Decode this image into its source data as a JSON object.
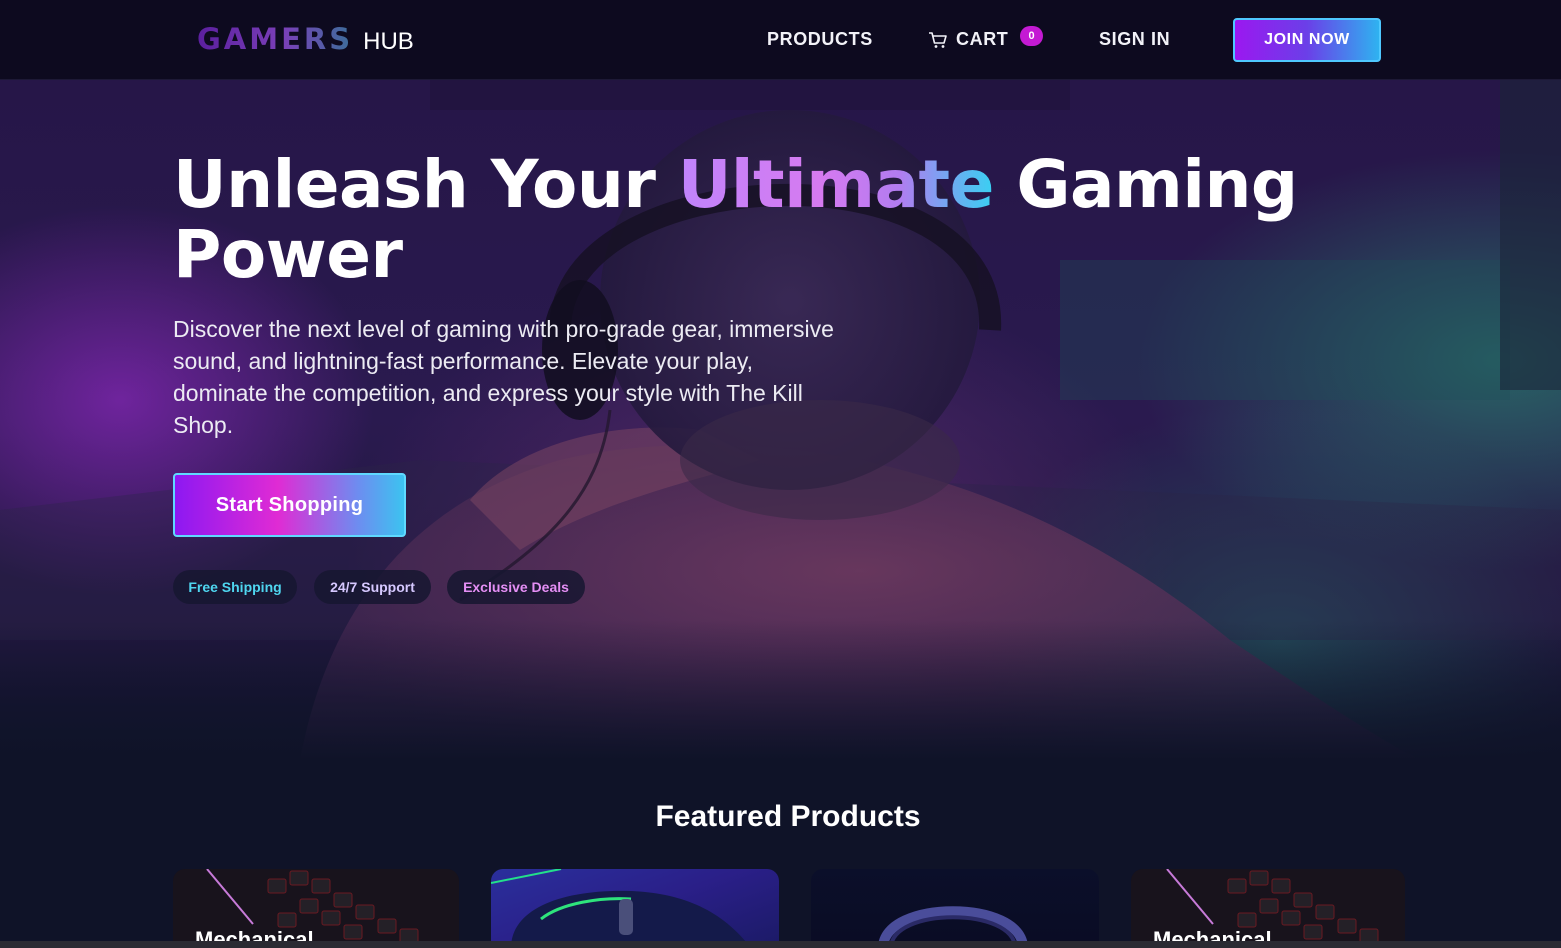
{
  "nav": {
    "logo_main": "GAMERS",
    "logo_sub": "HUB",
    "products": "PRODUCTS",
    "cart": "CART",
    "cart_count": "0",
    "signin": "SIGN IN",
    "join": "JOIN NOW"
  },
  "hero": {
    "headline_before": "Unleash Your ",
    "headline_accent": "Ultimate",
    "headline_after": " Gaming Power",
    "subtext": "Discover the next level of gaming with pro-grade gear, immersive sound, and lightning-fast performance. Elevate your play, dominate the competition, and express your style with The Kill Shop.",
    "cta": "Start Shopping",
    "chips": [
      "Free Shipping",
      "24/7 Support",
      "Exclusive Deals"
    ]
  },
  "featured": {
    "title": "Featured Products",
    "cards": [
      {
        "title": "Mechanical"
      },
      {
        "title": ""
      },
      {
        "title": ""
      },
      {
        "title": "Mechanical"
      }
    ]
  },
  "colors": {
    "accent_purple": "#9b18f0",
    "accent_cyan": "#2fb2f0",
    "badge": "#c41ad3",
    "background": "#0f1328"
  },
  "icons": {
    "cart": "cart-icon"
  }
}
